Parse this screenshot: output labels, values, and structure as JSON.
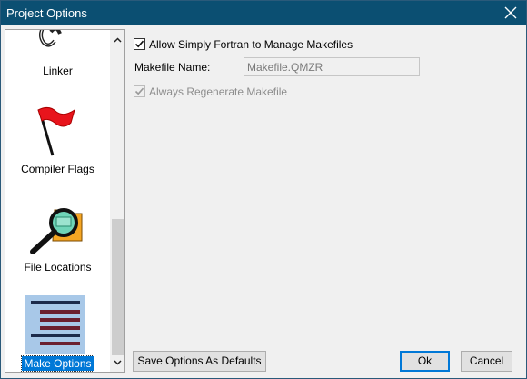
{
  "window": {
    "title": "Project Options"
  },
  "sidebar": {
    "items": [
      {
        "label": "Linker",
        "icon": "chain-link-icon"
      },
      {
        "label": "Compiler Flags",
        "icon": "red-flag-icon"
      },
      {
        "label": "File Locations",
        "icon": "magnifier-folder-icon"
      },
      {
        "label": "Make Options",
        "icon": "makefile-lines-icon",
        "selected": true
      }
    ]
  },
  "options": {
    "manage_makefiles_label": "Allow Simply Fortran to Manage Makefiles",
    "manage_makefiles_checked": true,
    "makefile_name_label": "Makefile Name:",
    "makefile_name_value": "Makefile.QMZR",
    "always_regenerate_label": "Always Regenerate Makefile",
    "always_regenerate_checked": true
  },
  "buttons": {
    "save_defaults": "Save Options As Defaults",
    "ok": "Ok",
    "cancel": "Cancel"
  },
  "colors": {
    "titlebar": "#0b4f72",
    "selection": "#0078d7",
    "flag_red": "#e8141c",
    "makefile_navy": "#1c2a4a",
    "makefile_maroon": "#6b2030"
  }
}
